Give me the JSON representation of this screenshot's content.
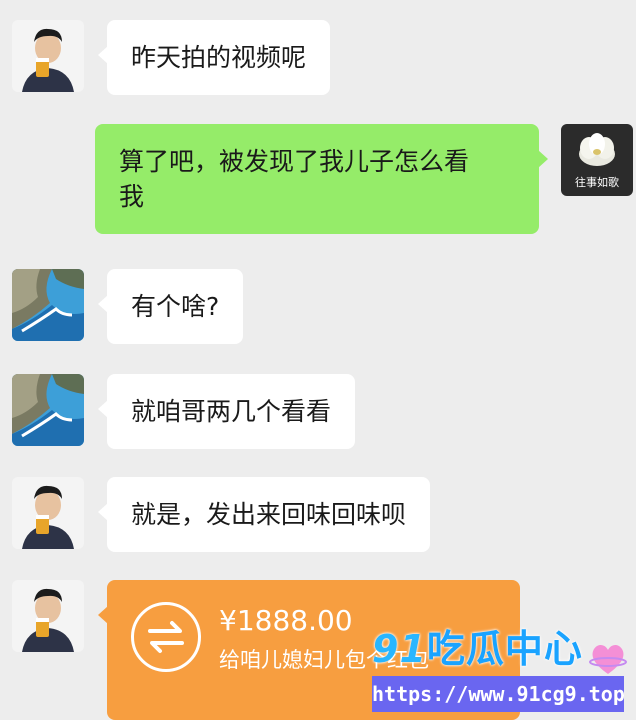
{
  "messages": [
    {
      "side": "left",
      "avatar": "man-avatar",
      "text": "昨天拍的视频呢"
    },
    {
      "side": "right",
      "avatar": "flower-avatar",
      "text_line1": "算了吧，被发现了我儿子怎么看",
      "text_line2": "我"
    },
    {
      "side": "left",
      "avatar": "coast-avatar",
      "text": "有个啥?"
    },
    {
      "side": "left",
      "avatar": "coast-avatar",
      "text": "就咱哥两几个看看"
    },
    {
      "side": "left",
      "avatar": "man-avatar",
      "text": "就是，发出来回味回味呗"
    }
  ],
  "self_avatar": {
    "caption": "往事如歌"
  },
  "transfer": {
    "amount": "¥1888.00",
    "note": "给咱儿媳妇儿包个红包",
    "icon": "transfer-arrows-icon"
  },
  "watermark": {
    "logo_num": "91",
    "logo_text": "吃瓜中心",
    "url": "https://www.91cg9.top"
  },
  "colors": {
    "background": "#ededed",
    "bubble_left": "#ffffff",
    "bubble_right": "#95ec69",
    "transfer": "#f79e40"
  }
}
